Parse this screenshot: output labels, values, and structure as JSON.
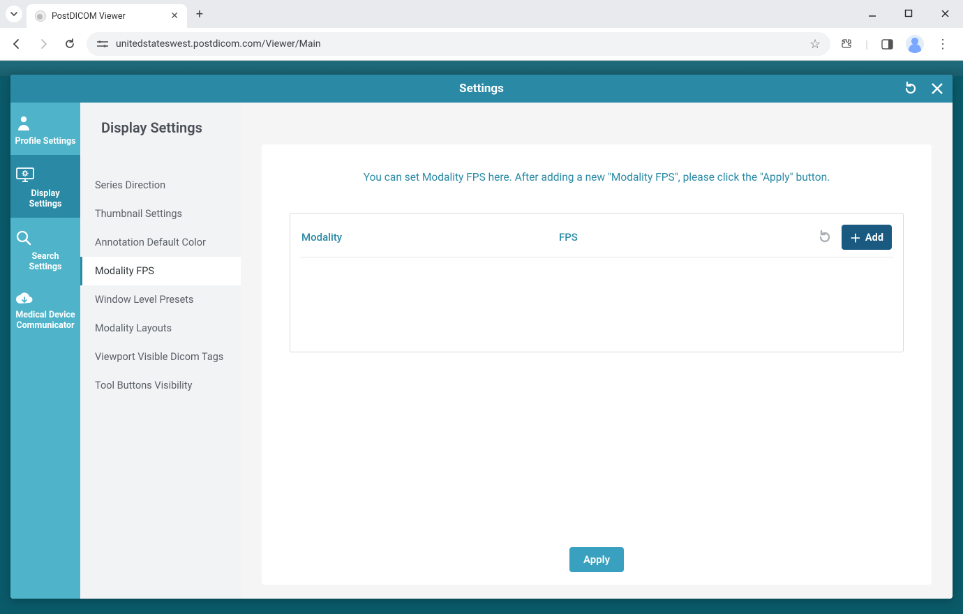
{
  "browser": {
    "tab_title": "PostDICOM Viewer",
    "url": "unitedstateswest.postdicom.com/Viewer/Main"
  },
  "modal": {
    "title": "Settings"
  },
  "sidebar": {
    "items": [
      {
        "label": "Profile Settings"
      },
      {
        "label": "Display Settings"
      },
      {
        "label": "Search Settings"
      },
      {
        "label": "Medical Device Communicator"
      }
    ]
  },
  "page": {
    "heading": "Display Settings",
    "subitems": [
      {
        "label": "Series Direction"
      },
      {
        "label": "Thumbnail Settings"
      },
      {
        "label": "Annotation Default Color"
      },
      {
        "label": "Modality FPS"
      },
      {
        "label": "Window Level Presets"
      },
      {
        "label": "Modality Layouts"
      },
      {
        "label": "Viewport Visible Dicom Tags"
      },
      {
        "label": "Tool Buttons Visibility"
      }
    ],
    "info": "You can set Modality FPS here. After adding a new \"Modality FPS\", please click the \"Apply\" button.",
    "table": {
      "col_modality": "Modality",
      "col_fps": "FPS",
      "add_label": "Add"
    },
    "apply_label": "Apply"
  }
}
